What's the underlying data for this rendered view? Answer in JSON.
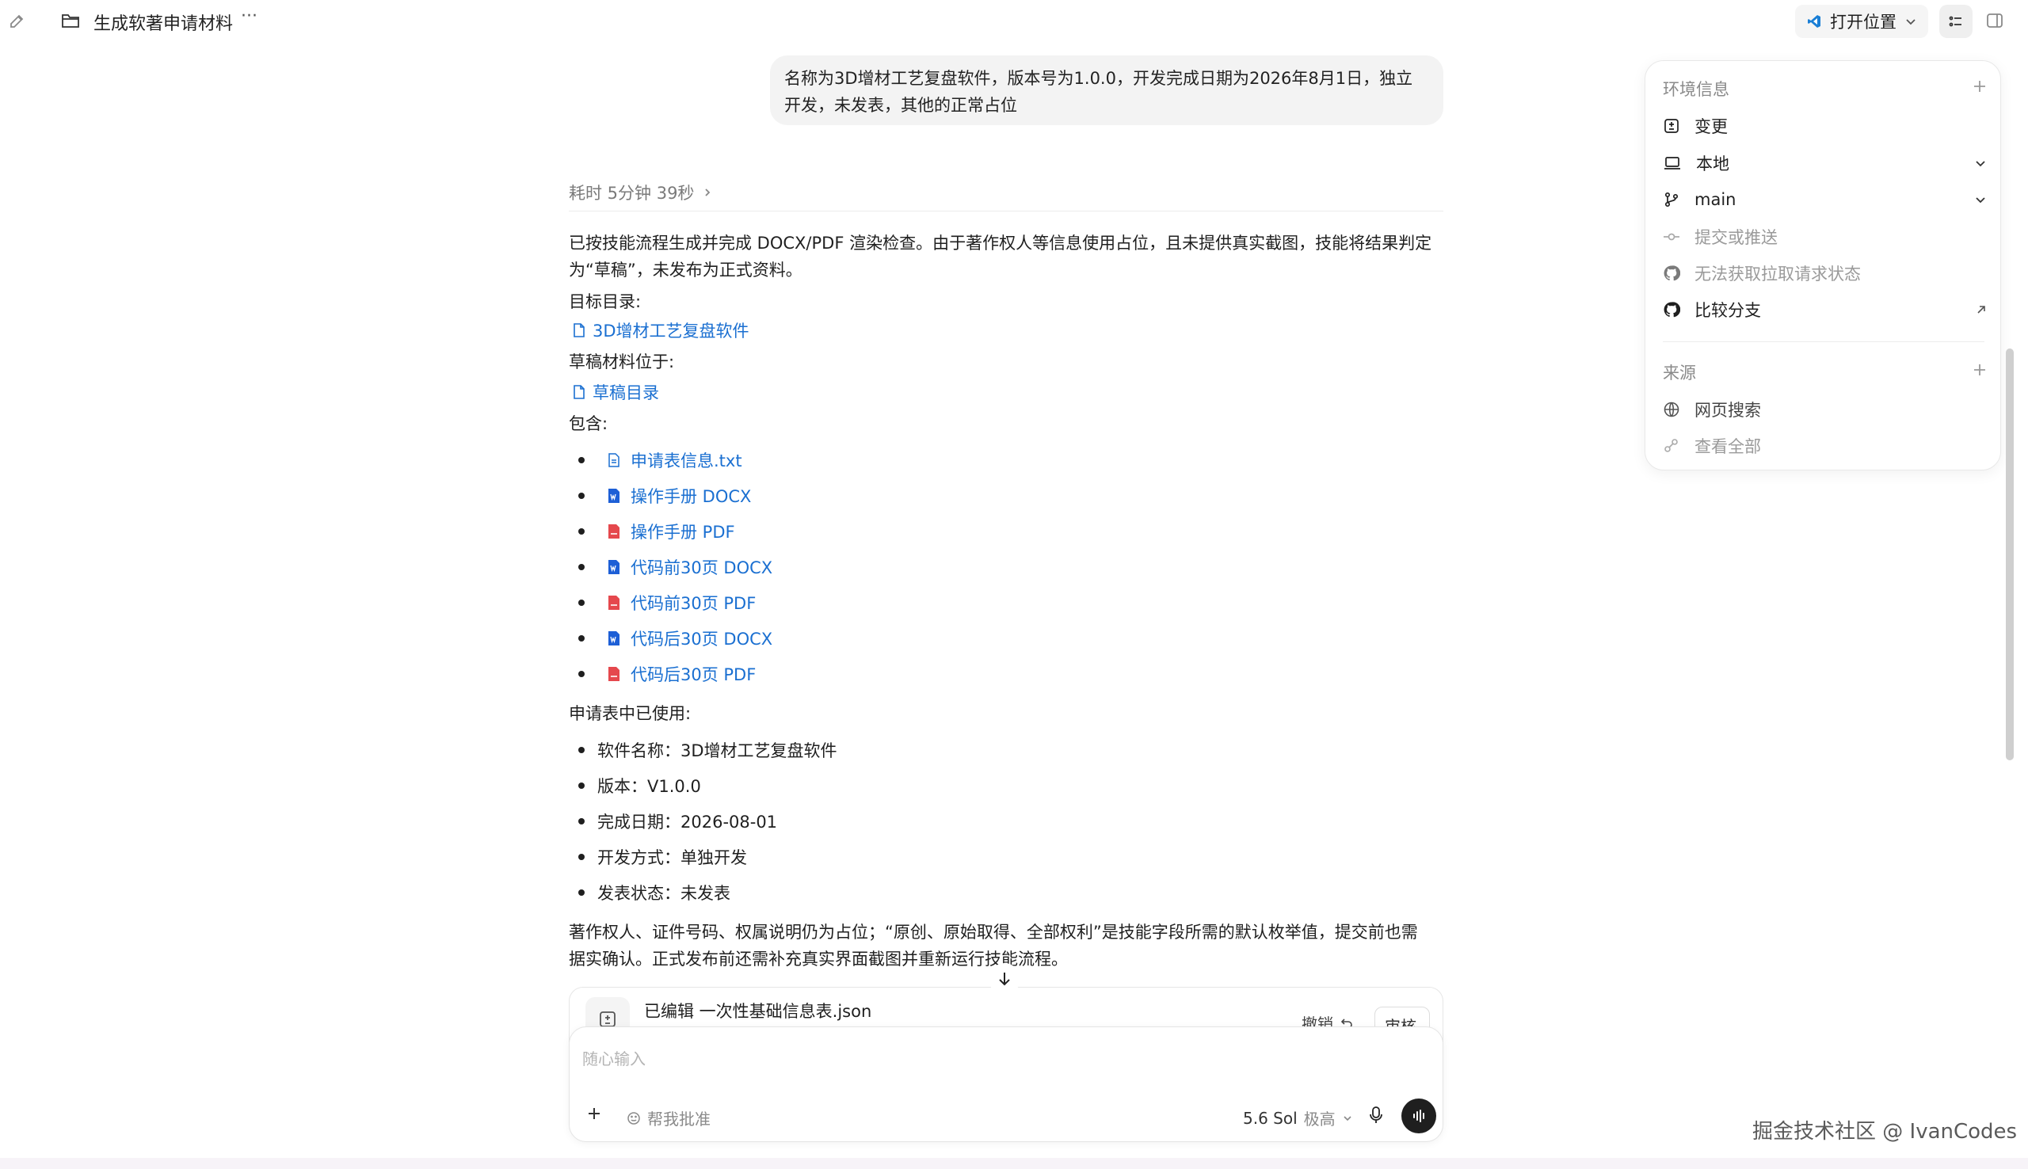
{
  "topbar": {
    "title": "生成软著申请材料",
    "more": "···",
    "open_location": "打开位置"
  },
  "user_message": "名称为3D增材工艺复盘软件，版本号为1.0.0，开发完成日期为2026年8月1日，独立开发，未发表，其他的正常占位",
  "duration": "耗时 5分钟 39秒",
  "response": {
    "intro": "已按技能流程生成并完成 DOCX/PDF 渲染检查。由于著作权人等信息使用占位，且未提供真实截图，技能将结果判定为“草稿”，未发布为正式资料。",
    "target_dir_label": "目标目录:",
    "target_dir_link": "3D增材工艺复盘软件",
    "draft_label": "草稿材料位于:",
    "draft_link": "草稿目录",
    "contains_label": "包含:",
    "files": [
      {
        "name": "申请表信息.txt",
        "kind": "txt"
      },
      {
        "name": "操作手册 DOCX",
        "kind": "docx"
      },
      {
        "name": "操作手册 PDF",
        "kind": "pdf"
      },
      {
        "name": "代码前30页 DOCX",
        "kind": "docx"
      },
      {
        "name": "代码前30页 PDF",
        "kind": "pdf"
      },
      {
        "name": "代码后30页 DOCX",
        "kind": "docx"
      },
      {
        "name": "代码后30页 PDF",
        "kind": "pdf"
      }
    ],
    "used_label": "申请表中已使用:",
    "used_items": [
      "软件名称：3D增材工艺复盘软件",
      "版本：V1.0.0",
      "完成日期：2026-08-01",
      "开发方式：单独开发",
      "发表状态：未发表"
    ],
    "note": "著作权人、证件号码、权属说明仍为占位；“原创、原始取得、全部权利”是技能字段所需的默认枚举值，提交前也需据实确认。正式发布前还需补充真实界面截图并重新运行技能流程。"
  },
  "edit_card": {
    "title": "已编辑 一次性基础信息表.json",
    "undo": "撤销",
    "review": "审核"
  },
  "composer": {
    "placeholder": "随心输入",
    "approve": "帮我批准",
    "model": "5.6 Sol",
    "level": "极高"
  },
  "panel": {
    "env_title": "环境信息",
    "env_items": [
      {
        "label": "变更",
        "icon": "diff-icon",
        "muted": false
      },
      {
        "label": "本地",
        "icon": "laptop-icon",
        "muted": false
      },
      {
        "label": "main",
        "icon": "branch-icon",
        "muted": false
      },
      {
        "label": "提交或推送",
        "icon": "commit-icon",
        "muted": true
      },
      {
        "label": "无法获取拉取请求状态",
        "icon": "github-icon",
        "muted": true
      },
      {
        "label": "比较分支",
        "icon": "github-icon",
        "muted": false
      }
    ],
    "source_title": "来源",
    "source_items": [
      {
        "label": "网页搜索",
        "icon": "globe-icon",
        "muted": false
      },
      {
        "label": "查看全部",
        "icon": "link-icon",
        "muted": true
      }
    ]
  },
  "watermark": "掘金技术社区 @ IvanCodes",
  "colors": {
    "link": "#1a6fd1",
    "docx": "#1d5fd6",
    "pdf": "#e5484d"
  }
}
